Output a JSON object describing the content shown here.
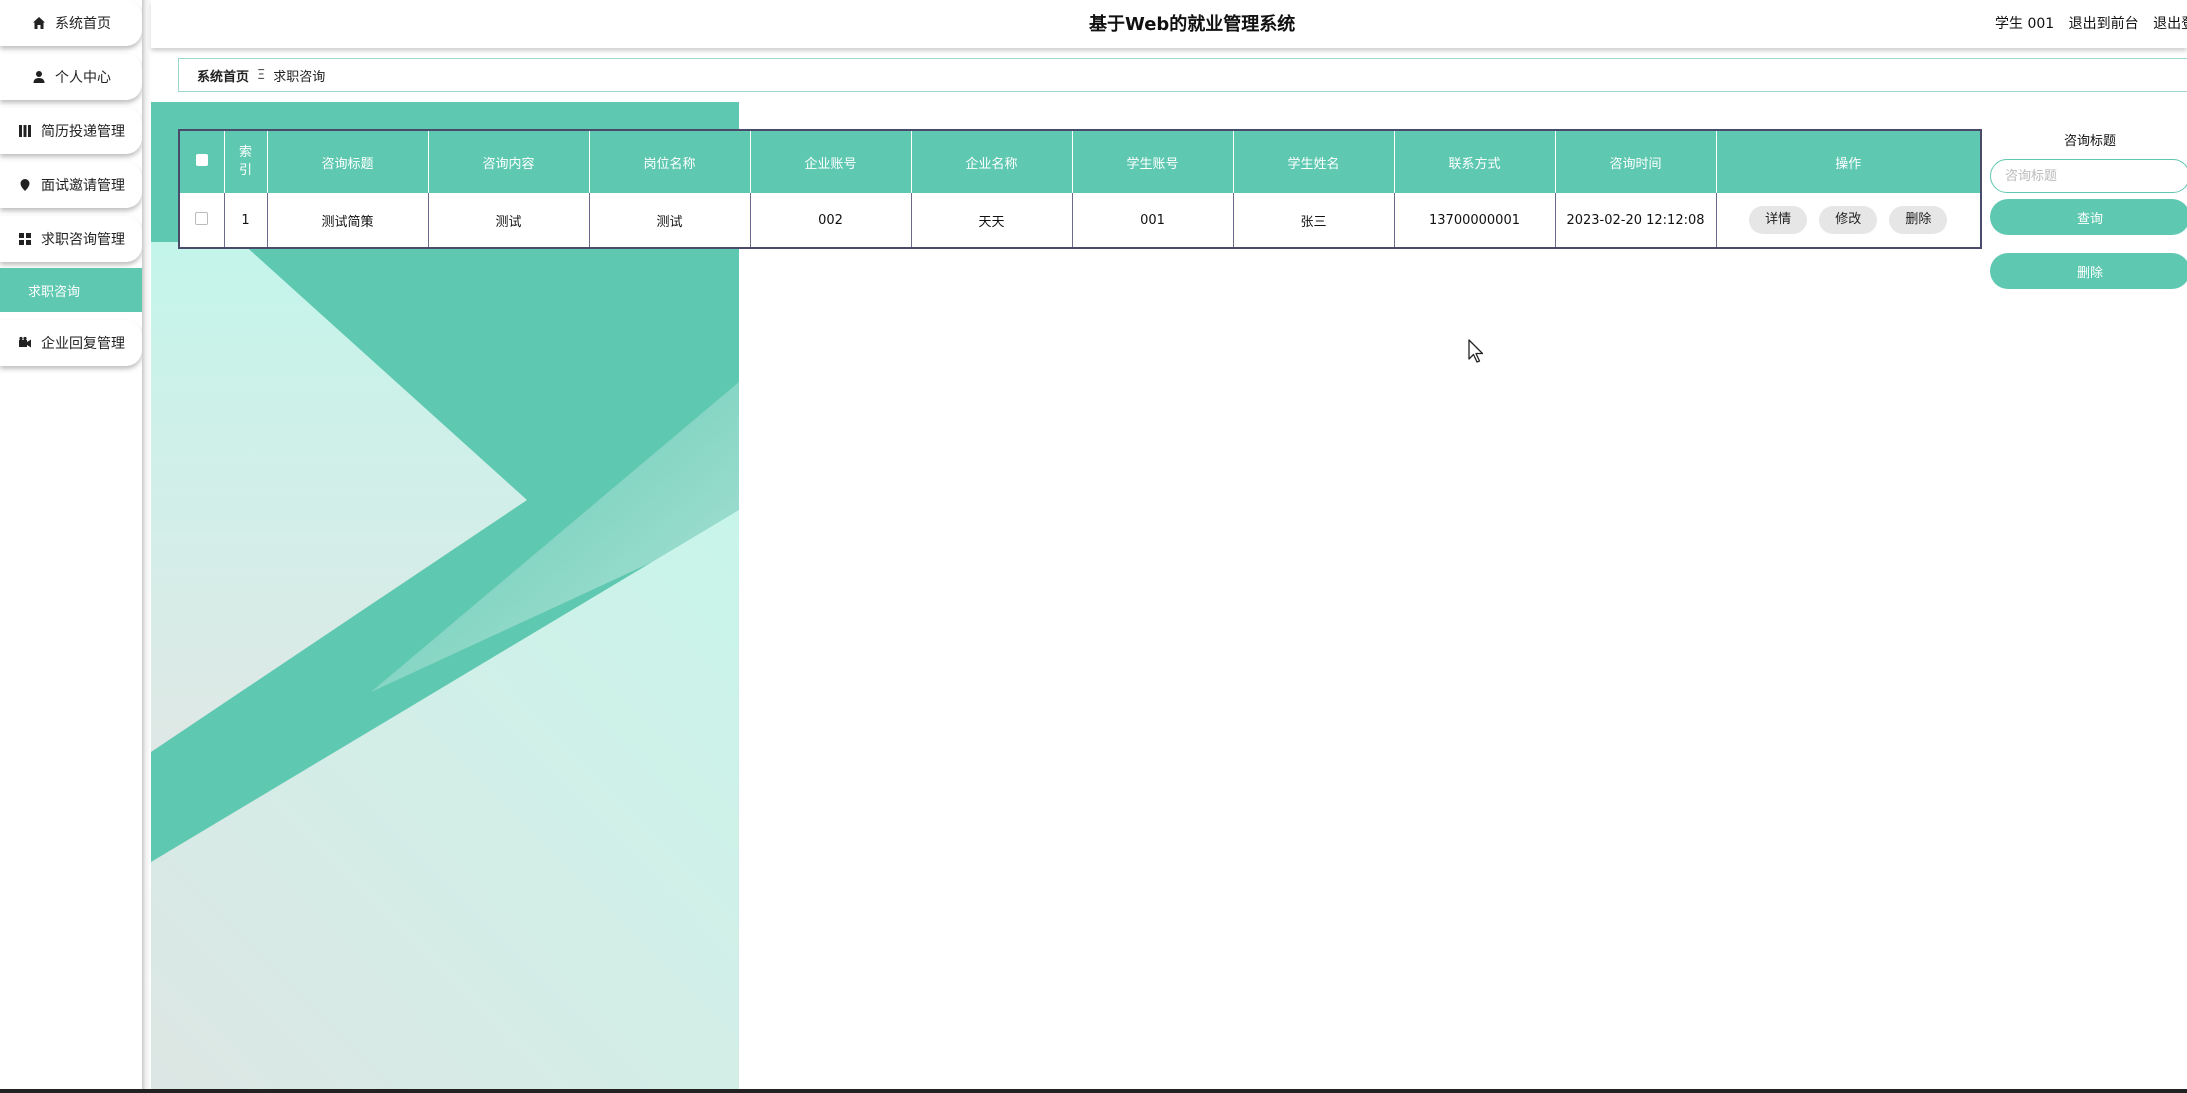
{
  "sidebar": {
    "items": [
      {
        "label": "系统首页",
        "icon": "home-icon"
      },
      {
        "label": "个人中心",
        "icon": "user-icon"
      },
      {
        "label": "简历投递管理",
        "icon": "grid-bars-icon"
      },
      {
        "label": "面试邀请管理",
        "icon": "location-pin-icon"
      },
      {
        "label": "求职咨询管理",
        "icon": "grid-squares-icon"
      },
      {
        "label": "企业回复管理",
        "icon": "video-camera-icon"
      }
    ],
    "submenu": {
      "label": "求职咨询"
    }
  },
  "header": {
    "title": "基于Web的就业管理系统",
    "user": "学生 001",
    "back_to_front": "退出到前台",
    "logout": "退出登录"
  },
  "breadcrumb": {
    "home": "系统首页",
    "separator": "Ξ",
    "current": "求职咨询"
  },
  "table": {
    "columns": [
      "索引",
      "咨询标题",
      "咨询内容",
      "岗位名称",
      "企业账号",
      "企业名称",
      "学生账号",
      "学生姓名",
      "联系方式",
      "咨询时间",
      "操作"
    ],
    "rows": [
      {
        "index": "1",
        "title": "测试简策",
        "content": "测试",
        "position": "测试",
        "company_account": "002",
        "company_name": "天天",
        "student_account": "001",
        "student_name": "张三",
        "phone": "13700000001",
        "time": "2023-02-20 12:12:08",
        "actions": [
          "详情",
          "修改",
          "删除"
        ]
      }
    ]
  },
  "search": {
    "label": "咨询标题",
    "placeholder": "咨询标题",
    "value": "",
    "query_button": "查询",
    "delete_button": "删除"
  },
  "colors": {
    "accent": "#5fc8b1",
    "table_border": "#4a4a6a"
  }
}
